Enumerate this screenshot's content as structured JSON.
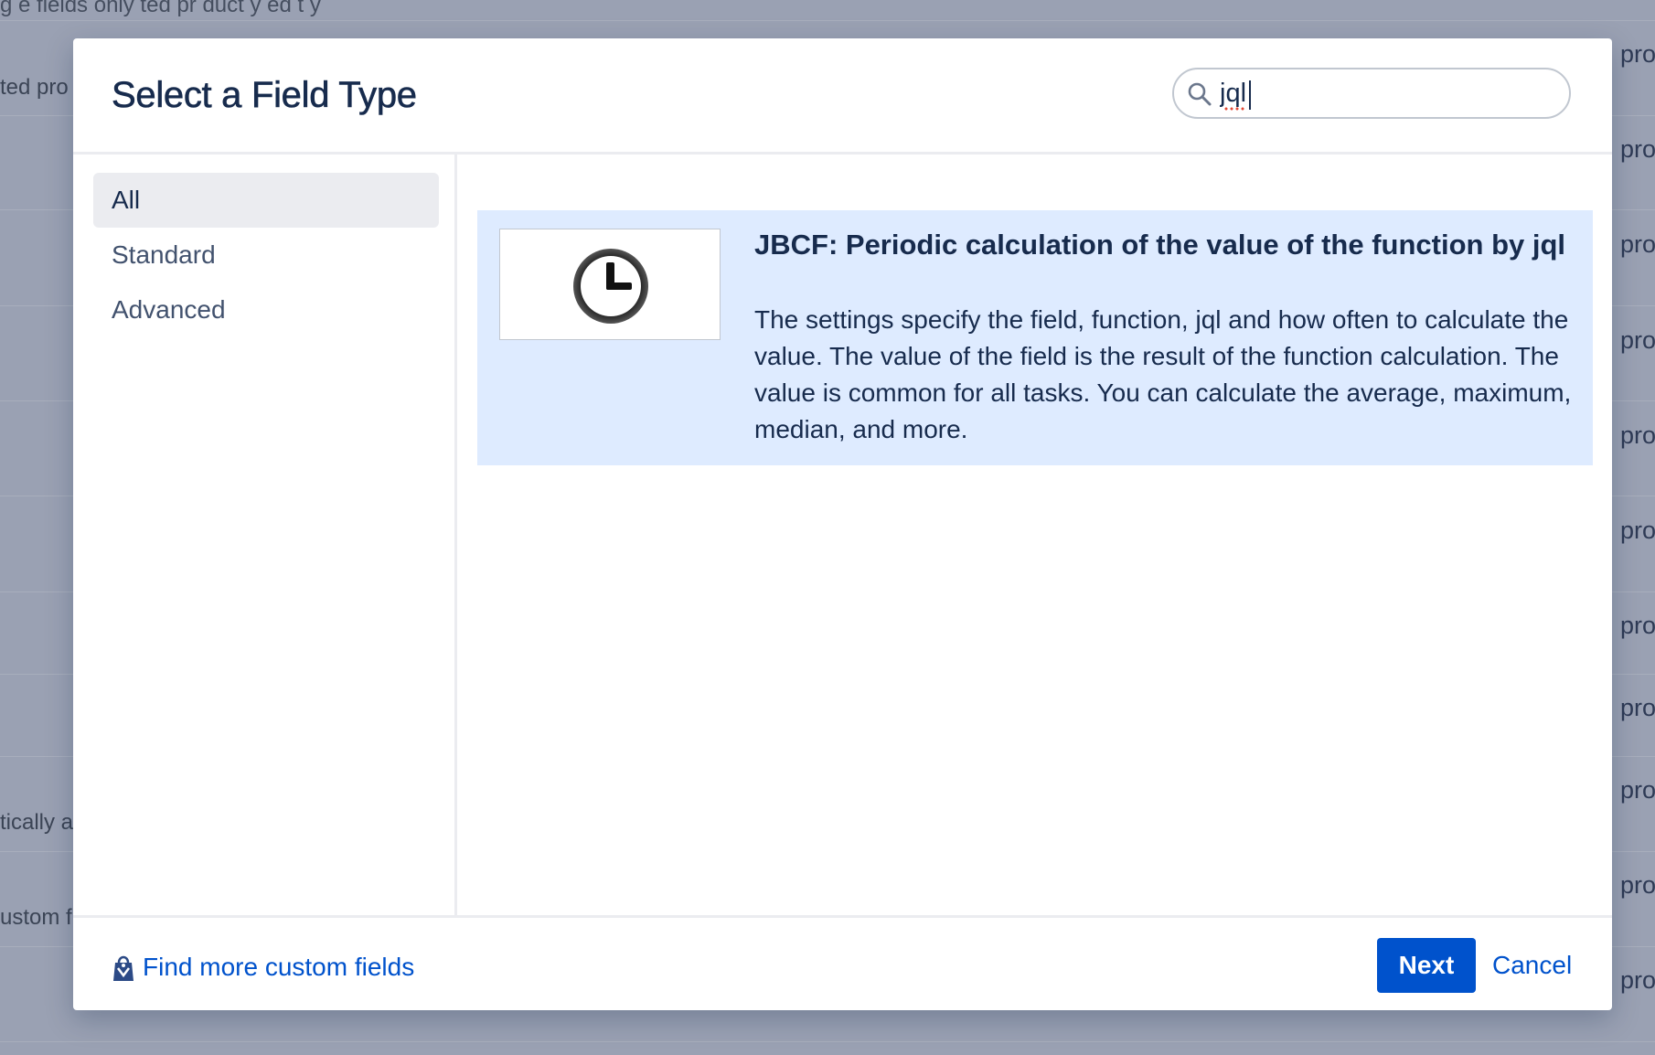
{
  "background": {
    "top_text": "g e fields only   ted  pr duct  y   ed  t    y",
    "left_fragments": [
      "ted pro",
      "tically a",
      "ustom f"
    ],
    "right_fragments": [
      "pro",
      "pro",
      "pro",
      "pro",
      "pro",
      "pro",
      "pro",
      "pro",
      "pro",
      "pro",
      "pro"
    ]
  },
  "dialog": {
    "title": "Select a Field Type",
    "search": {
      "value": "jql",
      "icon": "search-icon"
    }
  },
  "sidebar": {
    "items": [
      {
        "label": "All",
        "active": true
      },
      {
        "label": "Standard",
        "active": false
      },
      {
        "label": "Advanced",
        "active": false
      }
    ]
  },
  "results": [
    {
      "title": "JBCF: Periodic calculation of the value of the function by jql",
      "description": "The settings specify the field, function, jql and how often to calculate the value. The value of the field is the result of the function calculation. The value is common for all tasks. You can calculate the average, maximum, median, and more.",
      "icon": "clock-icon",
      "selected": true
    }
  ],
  "footer": {
    "find_more_label": "Find more custom fields",
    "find_more_icon": "marketplace-bag-icon",
    "next_label": "Next",
    "cancel_label": "Cancel"
  },
  "colors": {
    "primary": "#0052cc",
    "selected_bg": "#deebff",
    "text": "#172b4d",
    "overlay": "#9aa1b3"
  }
}
